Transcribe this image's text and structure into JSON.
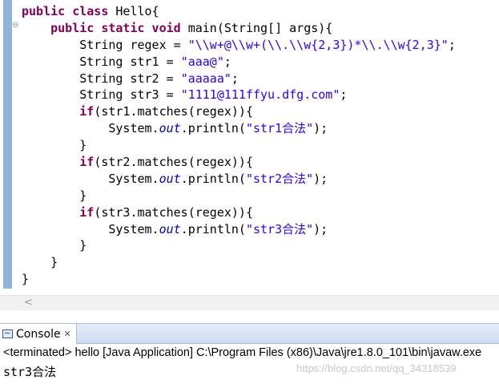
{
  "editor": {
    "lines": [
      [
        {
          "t": "public class ",
          "c": "kw"
        },
        {
          "t": "Hello{",
          "c": ""
        }
      ],
      [
        {
          "t": "    ",
          "c": ""
        },
        {
          "t": "public static void ",
          "c": "kw"
        },
        {
          "t": "main(String[] args){",
          "c": ""
        }
      ],
      [
        {
          "t": "        String regex = ",
          "c": ""
        },
        {
          "t": "\"\\\\w+@\\\\w+(\\\\.\\\\w{2,3})*\\\\.\\\\w{2,3}\"",
          "c": "str"
        },
        {
          "t": ";",
          "c": ""
        }
      ],
      [
        {
          "t": "        String str1 = ",
          "c": ""
        },
        {
          "t": "\"aaa@\"",
          "c": "str"
        },
        {
          "t": ";",
          "c": ""
        }
      ],
      [
        {
          "t": "        String str2 = ",
          "c": ""
        },
        {
          "t": "\"aaaaa\"",
          "c": "str"
        },
        {
          "t": ";",
          "c": ""
        }
      ],
      [
        {
          "t": "        String str3 = ",
          "c": ""
        },
        {
          "t": "\"1111@111ffyu.dfg.com\"",
          "c": "str"
        },
        {
          "t": ";",
          "c": ""
        }
      ],
      [
        {
          "t": "        ",
          "c": ""
        },
        {
          "t": "if",
          "c": "kw"
        },
        {
          "t": "(str1.matches(regex)){",
          "c": ""
        }
      ],
      [
        {
          "t": "            System.",
          "c": ""
        },
        {
          "t": "out",
          "c": "it"
        },
        {
          "t": ".println(",
          "c": ""
        },
        {
          "t": "\"str1合法\"",
          "c": "str"
        },
        {
          "t": ");",
          "c": ""
        }
      ],
      [
        {
          "t": "        }",
          "c": ""
        }
      ],
      [
        {
          "t": "        ",
          "c": ""
        },
        {
          "t": "if",
          "c": "kw"
        },
        {
          "t": "(str2.matches(regex)){",
          "c": ""
        }
      ],
      [
        {
          "t": "            System.",
          "c": ""
        },
        {
          "t": "out",
          "c": "it"
        },
        {
          "t": ".println(",
          "c": ""
        },
        {
          "t": "\"str2合法\"",
          "c": "str"
        },
        {
          "t": ");",
          "c": ""
        }
      ],
      [
        {
          "t": "        }",
          "c": ""
        }
      ],
      [
        {
          "t": "        ",
          "c": ""
        },
        {
          "t": "if",
          "c": "kw"
        },
        {
          "t": "(str3.matches(regex)){",
          "c": ""
        }
      ],
      [
        {
          "t": "            System.",
          "c": ""
        },
        {
          "t": "out",
          "c": "it"
        },
        {
          "t": ".println(",
          "c": ""
        },
        {
          "t": "\"str3合法\"",
          "c": "str"
        },
        {
          "t": ");",
          "c": ""
        }
      ],
      [
        {
          "t": "        }",
          "c": ""
        }
      ],
      [
        {
          "t": "    }",
          "c": ""
        }
      ],
      [
        {
          "t": "}",
          "c": ""
        }
      ]
    ],
    "fold_marker": "⊖",
    "colors": {
      "keyword": "#7f0055",
      "string": "#2a00ff",
      "field": "#0000c0"
    }
  },
  "scrollbar": {
    "left_arrow": "<"
  },
  "console": {
    "tab_label": "Console",
    "close_glyph": "✕",
    "status": "<terminated> hello [Java Application] C:\\Program Files (x86)\\Java\\jre1.8.0_101\\bin\\javaw.exe",
    "output": "str3合法",
    "watermark": "https://blog.csdn.net/qq_34318539"
  }
}
